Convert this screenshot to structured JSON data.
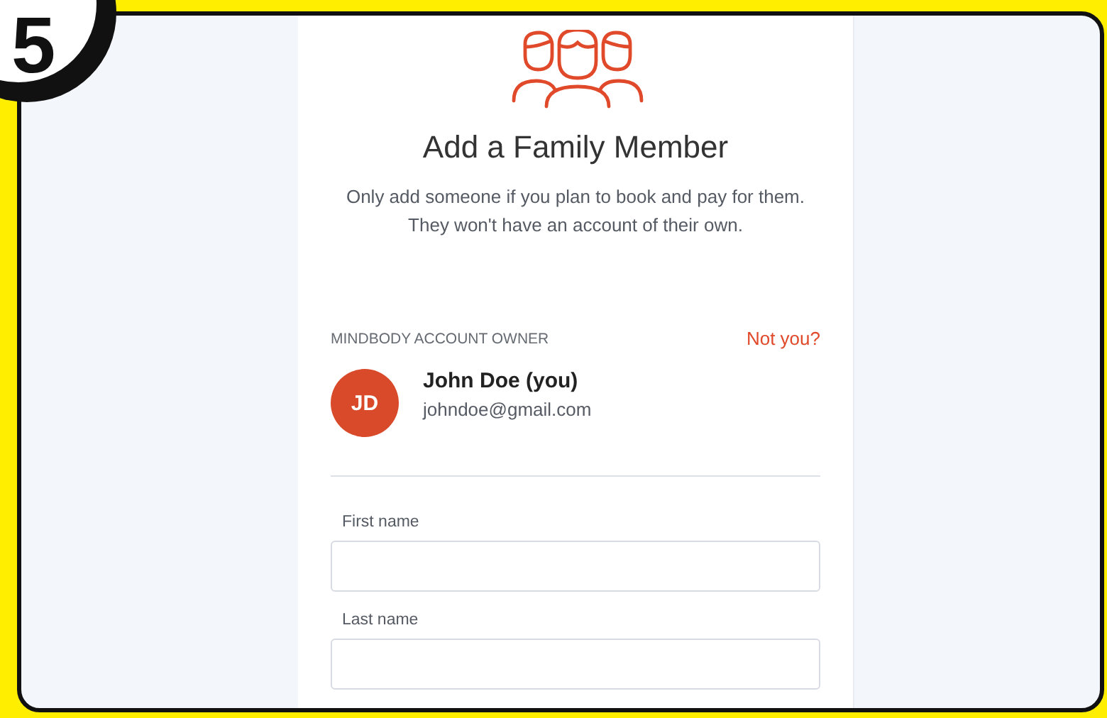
{
  "step_number": "5",
  "dialog": {
    "title": "Add a Family Member",
    "description": [
      "Only add someone if you plan to book and pay for them.",
      "They won't have an account of their own."
    ]
  },
  "account_owner": {
    "heading": "MINDBODY ACCOUNT OWNER",
    "switch_link": "Not you?",
    "initials": "JD",
    "name": "John Doe (you)",
    "email": "johndoe@gmail.com"
  },
  "fields": [
    {
      "label": "First name"
    },
    {
      "label": "Last name"
    }
  ]
}
